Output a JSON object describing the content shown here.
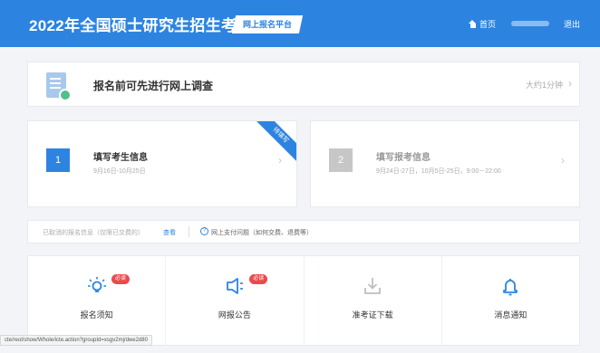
{
  "header": {
    "title": "2022年全国硕士研究生招生考试",
    "badge": "网上报名平台",
    "home_label": "首页",
    "logout_label": "退出"
  },
  "survey": {
    "text": "报名前可先进行网上调查",
    "time": "大约1分钟"
  },
  "steps": [
    {
      "number": "1",
      "title": "填写考生信息",
      "date": "9月16日-10月25日",
      "ribbon": "待填写"
    },
    {
      "number": "2",
      "title": "填写报考信息",
      "date": "9月24日-27日，10月5日-25日，9:00－22:00"
    }
  ],
  "info": {
    "cancelled": "已取消的报名信息（仅限已交费的）",
    "view": "查看",
    "help": "网上支付问题（如何交费、退费等）"
  },
  "quick_links": [
    {
      "label": "报名须知",
      "icon": "bulb-icon",
      "badge": "必读"
    },
    {
      "label": "网报公告",
      "icon": "megaphone-icon",
      "badge": "必读"
    },
    {
      "label": "准考证下载",
      "icon": "download-icon"
    },
    {
      "label": "消息通知",
      "icon": "bell-icon"
    }
  ],
  "status_url": "cte/reol/show/Whole/icte.action?groupId=xsgv2mj/dwe2d80",
  "colors": {
    "primary": "#2d84e0",
    "badge_red": "#e94b4b",
    "muted_step": "#c7c7c7"
  }
}
